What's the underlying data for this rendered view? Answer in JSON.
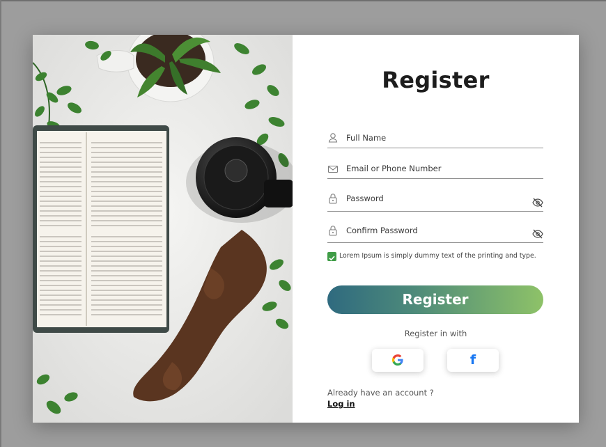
{
  "form": {
    "title": "Register",
    "fields": [
      {
        "label": "Full Name",
        "icon": "user-icon"
      },
      {
        "label": "Email or Phone Number",
        "icon": "mail-icon"
      },
      {
        "label": "Password",
        "icon": "lock-icon",
        "toggle": "eye-off-icon"
      },
      {
        "label": "Confirm Password",
        "icon": "lock-icon",
        "toggle": "eye-off-icon"
      }
    ],
    "consent": {
      "text": "Lorem Ipsum is simply dummy text of the printing and type.",
      "checked": true
    },
    "register_button": "Register",
    "register_with": "Register in with",
    "social": [
      {
        "name": "Google",
        "glyph": "G",
        "icon": "google-icon"
      },
      {
        "name": "Facebook",
        "glyph": "f",
        "icon": "facebook-icon",
        "color": "#1877f2"
      }
    ],
    "account_prompt": "Already have an account ?",
    "login_link": "Log in"
  },
  "colors": {
    "button_gradient_start": "#2f6a7f",
    "button_gradient_end": "#8ec268",
    "checkbox": "#3f9c46",
    "background": "#9d9d9d"
  },
  "hero_image": {
    "description_icon": "workspace-photo",
    "elements": [
      "book",
      "coffee-grounds",
      "french-press",
      "potted-plant",
      "vines"
    ]
  }
}
